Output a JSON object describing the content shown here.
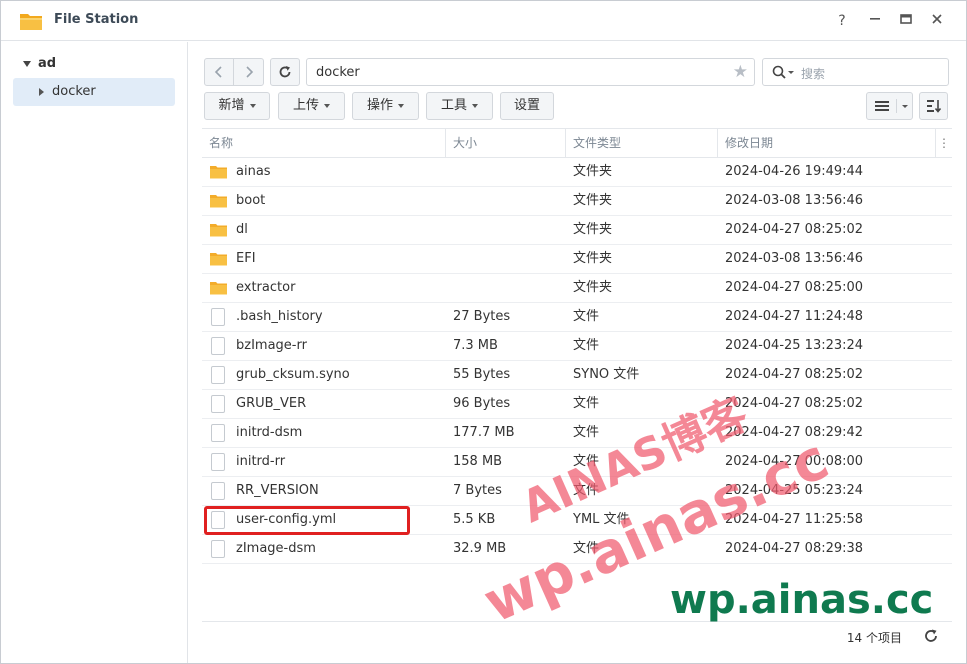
{
  "window": {
    "title": "File Station",
    "controls": {
      "help": "?",
      "minimize": "—",
      "maximize": "▭",
      "close": "✕"
    }
  },
  "sidebar": {
    "root_label": "ad",
    "items": [
      {
        "label": "docker"
      }
    ]
  },
  "toolbar": {
    "path": "docker",
    "search_placeholder": "搜索",
    "buttons": {
      "create": "新增",
      "upload": "上传",
      "action": "操作",
      "tools": "工具",
      "settings": "设置"
    }
  },
  "table": {
    "headers": {
      "name": "名称",
      "size": "大小",
      "type": "文件类型",
      "modified": "修改日期"
    },
    "rows": [
      {
        "name": "ainas",
        "size": "",
        "type": "文件夹",
        "modified": "2024-04-26 19:49:44",
        "kind": "folder"
      },
      {
        "name": "boot",
        "size": "",
        "type": "文件夹",
        "modified": "2024-03-08 13:56:46",
        "kind": "folder"
      },
      {
        "name": "dl",
        "size": "",
        "type": "文件夹",
        "modified": "2024-04-27 08:25:02",
        "kind": "folder"
      },
      {
        "name": "EFI",
        "size": "",
        "type": "文件夹",
        "modified": "2024-03-08 13:56:46",
        "kind": "folder"
      },
      {
        "name": "extractor",
        "size": "",
        "type": "文件夹",
        "modified": "2024-04-27 08:25:00",
        "kind": "folder"
      },
      {
        "name": ".bash_history",
        "size": "27 Bytes",
        "type": "文件",
        "modified": "2024-04-27 11:24:48",
        "kind": "file"
      },
      {
        "name": "bzImage-rr",
        "size": "7.3 MB",
        "type": "文件",
        "modified": "2024-04-25 13:23:24",
        "kind": "file"
      },
      {
        "name": "grub_cksum.syno",
        "size": "55 Bytes",
        "type": "SYNO 文件",
        "modified": "2024-04-27 08:25:02",
        "kind": "file"
      },
      {
        "name": "GRUB_VER",
        "size": "96 Bytes",
        "type": "文件",
        "modified": "2024-04-27 08:25:02",
        "kind": "file"
      },
      {
        "name": "initrd-dsm",
        "size": "177.7 MB",
        "type": "文件",
        "modified": "2024-04-27 08:29:42",
        "kind": "file"
      },
      {
        "name": "initrd-rr",
        "size": "158 MB",
        "type": "文件",
        "modified": "2024-04-27 00:08:00",
        "kind": "file"
      },
      {
        "name": "RR_VERSION",
        "size": "7 Bytes",
        "type": "文件",
        "modified": "2024-04-25 05:23:24",
        "kind": "file"
      },
      {
        "name": "user-config.yml",
        "size": "5.5 KB",
        "type": "YML 文件",
        "modified": "2024-04-27 11:25:58",
        "kind": "file"
      },
      {
        "name": "zImage-dsm",
        "size": "32.9 MB",
        "type": "文件",
        "modified": "2024-04-27 08:29:38",
        "kind": "file"
      }
    ]
  },
  "status": {
    "item_count": "14 个项目"
  },
  "watermarks": {
    "w1": "AINAS博客",
    "w2": "wp.ainas.cc",
    "w3": "wp.ainas.cc"
  },
  "colors": {
    "folder": "#f6b73c",
    "highlight": "#e02020",
    "selected": "#e1ecf8",
    "watermark": "#f05a6e",
    "watermark_green": "#0f7a4f"
  }
}
